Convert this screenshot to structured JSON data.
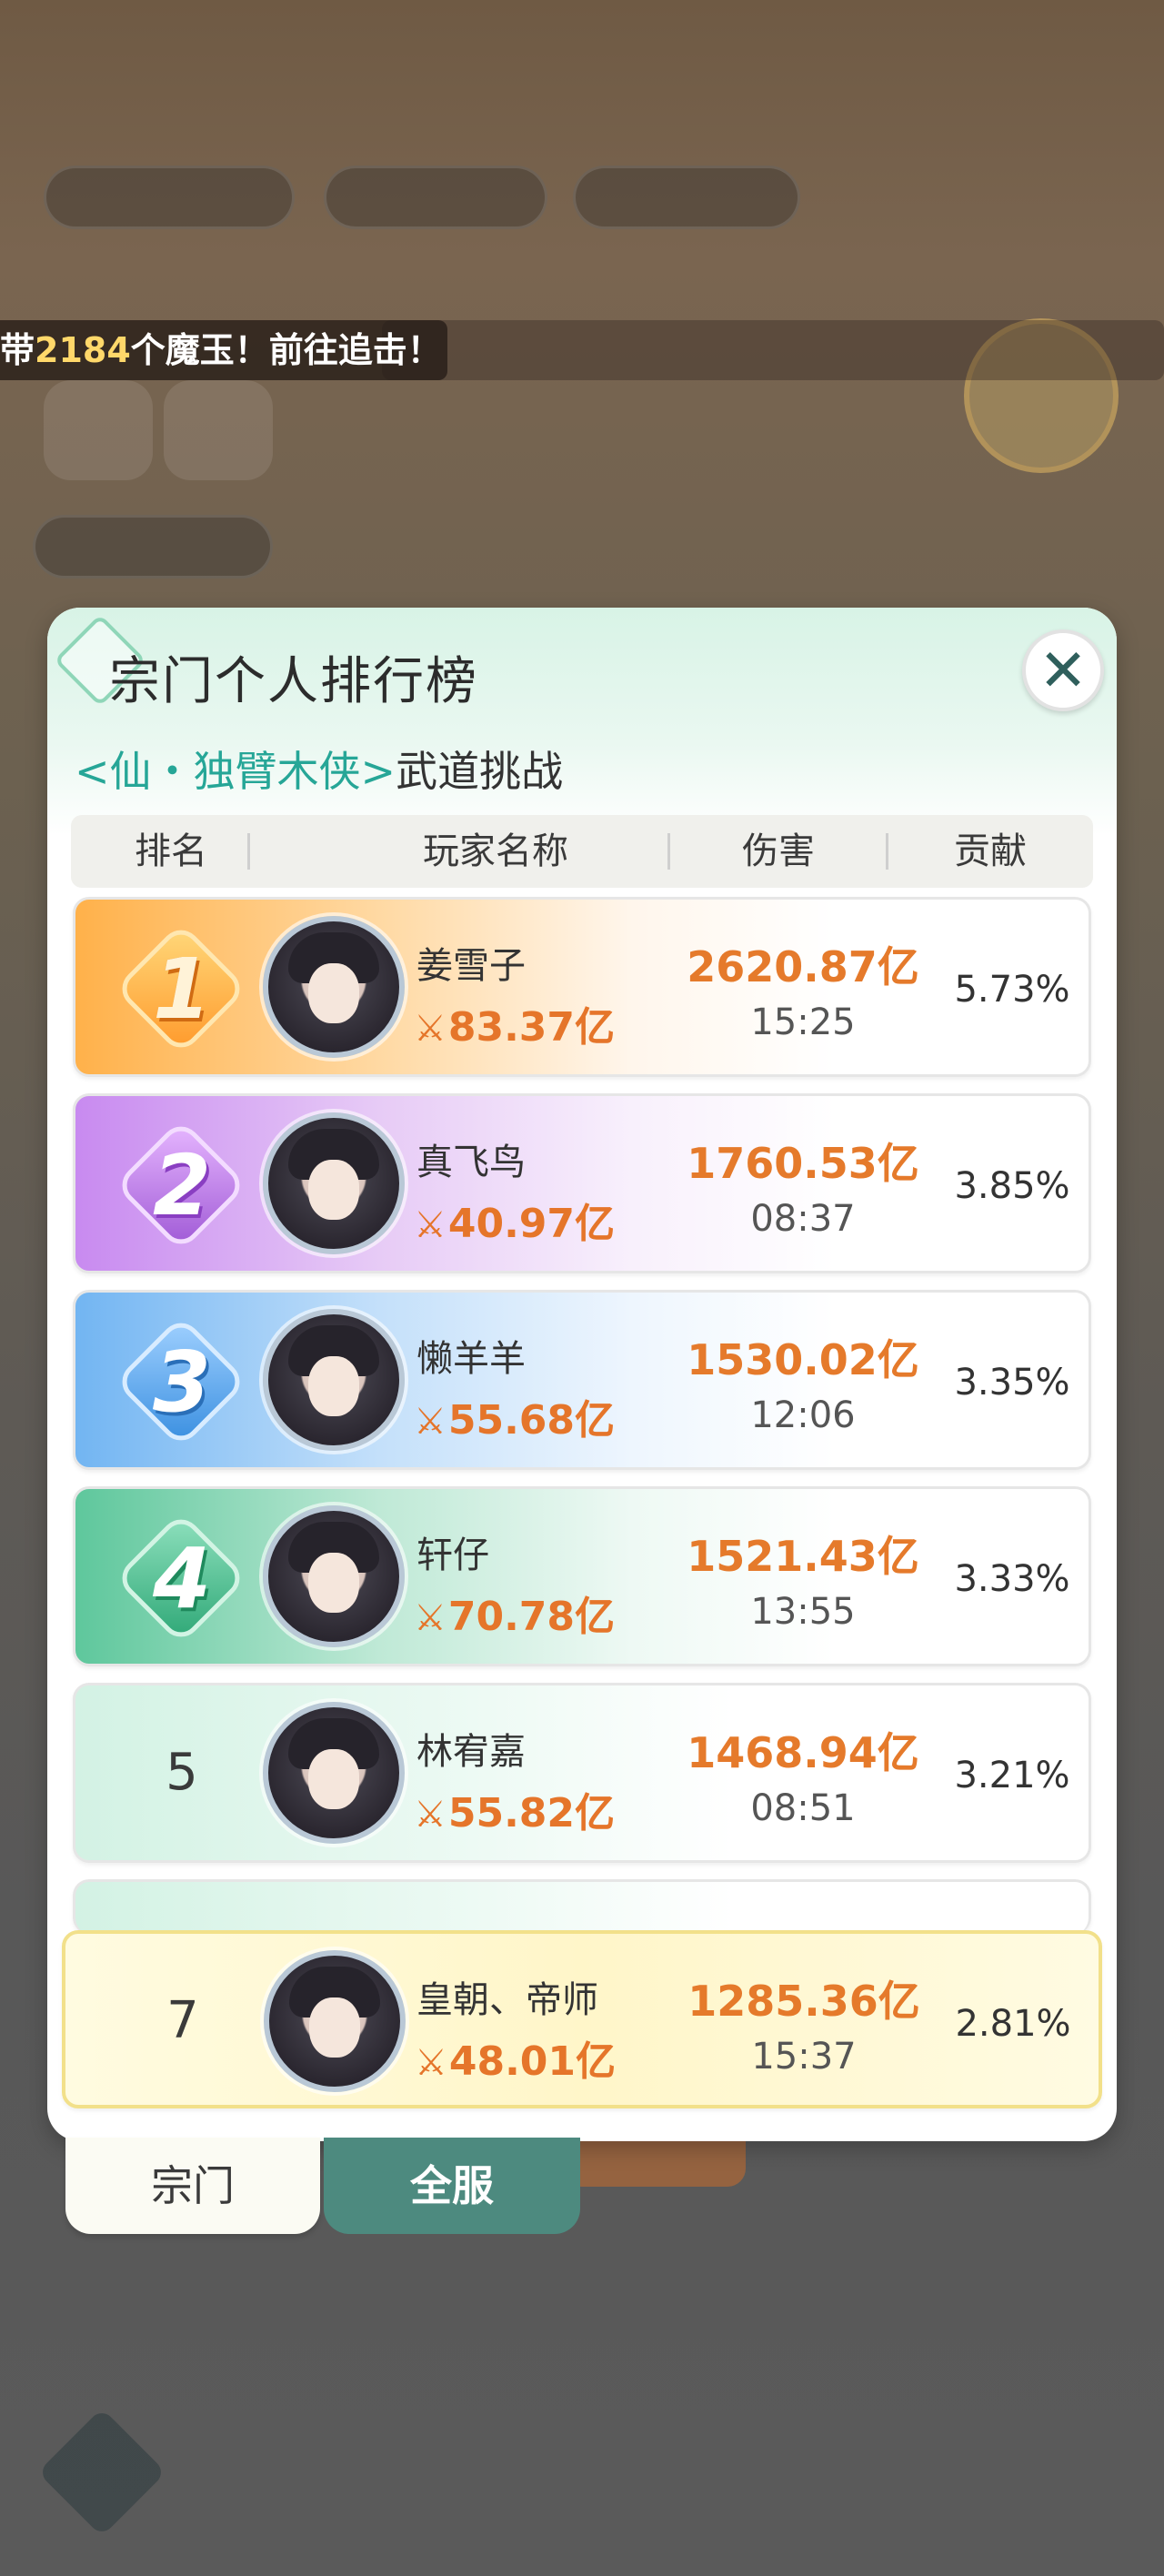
{
  "ticker": {
    "prefix": "带",
    "count": "2184",
    "suffix": "个魔玉！前往追击！"
  },
  "panel": {
    "title": "宗门个人排行榜",
    "close_label": "✕",
    "subtitle_event": "<仙・独臂木侠>",
    "subtitle_mode": "武道挑战"
  },
  "columns": {
    "rank": "排名",
    "player": "玩家名称",
    "damage": "伤害",
    "contribution": "贡献"
  },
  "rows": [
    {
      "rank": "1",
      "name": "姜雪子",
      "power": "83.37亿",
      "damage": "2620.87亿",
      "time": "15:25",
      "contribution": "5.73%"
    },
    {
      "rank": "2",
      "name": "真飞鸟",
      "power": "40.97亿",
      "damage": "1760.53亿",
      "time": "08:37",
      "contribution": "3.85%"
    },
    {
      "rank": "3",
      "name": "懒羊羊",
      "power": "55.68亿",
      "damage": "1530.02亿",
      "time": "12:06",
      "contribution": "3.35%"
    },
    {
      "rank": "4",
      "name": "轩仔",
      "power": "70.78亿",
      "damage": "1521.43亿",
      "time": "13:55",
      "contribution": "3.33%"
    },
    {
      "rank": "5",
      "name": "林宥嘉",
      "power": "55.82亿",
      "damage": "1468.94亿",
      "time": "08:51",
      "contribution": "3.21%"
    }
  ],
  "my_row": {
    "rank": "7",
    "name": "皇朝、帝师",
    "power": "48.01亿",
    "damage": "1285.36亿",
    "time": "15:37",
    "contribution": "2.81%"
  },
  "tabs": {
    "sect": "宗门",
    "all_server": "全服"
  },
  "icons": {
    "close": "close-icon",
    "power": "crossed-swords-icon"
  }
}
